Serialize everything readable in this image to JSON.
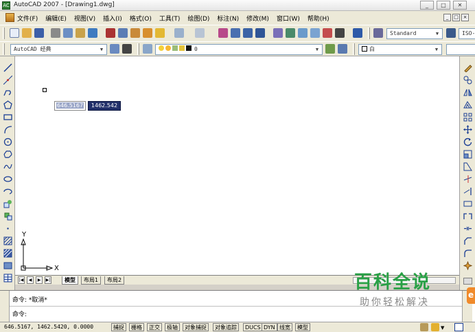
{
  "window": {
    "title": "AutoCAD 2007 - [Drawing1.dwg]",
    "app_icon_text": "AC",
    "minimize": "_",
    "maximize": "□",
    "close": "✕"
  },
  "menu": {
    "items": [
      "文件(F)",
      "编辑(E)",
      "视图(V)",
      "插入(I)",
      "格式(O)",
      "工具(T)",
      "绘图(D)",
      "标注(N)",
      "修改(M)",
      "窗口(W)",
      "帮助(H)"
    ],
    "mdi_minimize": "_",
    "mdi_restore": "□",
    "mdi_close": "×"
  },
  "toolbar": {
    "text_style": "Standard",
    "dim_style": "ISO-",
    "workspace": "AutoCAD 经典",
    "layer": "0",
    "color": "白"
  },
  "canvas": {
    "dyn_x": "646.5167",
    "dyn_y": "1462.542",
    "ucs_x": "X",
    "ucs_y": "Y"
  },
  "tabs": {
    "nav": [
      "|◀",
      "◀",
      "▶",
      "▶|"
    ],
    "items": [
      "模型",
      "布局1",
      "布局2"
    ]
  },
  "command": {
    "history": "命令: *取消*",
    "prompt": "命令:"
  },
  "status": {
    "coords": "646.5167,  1462.5420, 0.0000",
    "buttons": [
      "捕捉",
      "栅格",
      "正交",
      "极轴",
      "对象捕捉",
      "对象追踪",
      "DUCS",
      "DYN",
      "线宽",
      "模型"
    ]
  },
  "watermark": {
    "main": "百科全说",
    "sub": "助你轻松解决",
    "side": "e"
  }
}
